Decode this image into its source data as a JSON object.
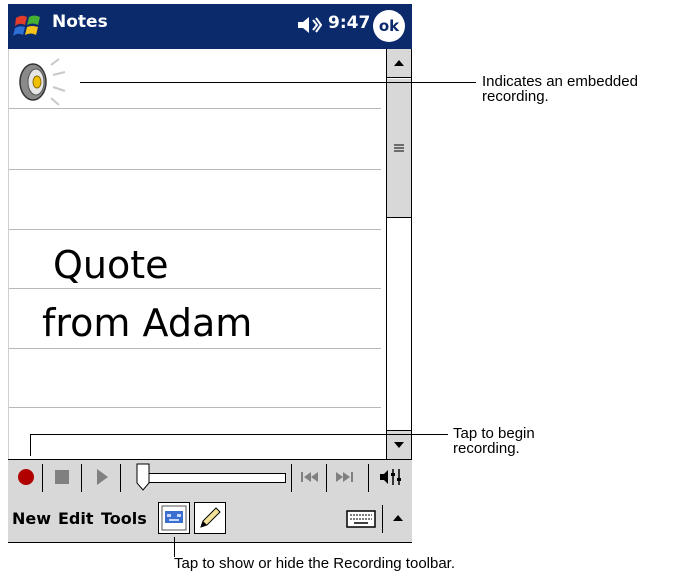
{
  "titlebar": {
    "app_title": "Notes",
    "time": "9:47",
    "ok_label": "ok"
  },
  "note": {
    "lines": [
      "Quote",
      "from Adam"
    ]
  },
  "menubar": {
    "items": [
      "New",
      "Edit",
      "Tools"
    ]
  },
  "callouts": {
    "recording_line1": "Indicates an embedded",
    "recording_line2": "recording.",
    "begin_line1": "Tap to begin",
    "begin_line2": "recording.",
    "toolbar_hint": "Tap to show or hide the Recording toolbar."
  },
  "icons": [
    "windows-start-icon",
    "speaker-icon",
    "embedded-recording-icon",
    "record-icon",
    "stop-icon",
    "play-icon",
    "skip-back-icon",
    "skip-forward-icon",
    "volume-icon",
    "recording-toolbar-icon",
    "pen-icon",
    "keyboard-icon",
    "input-menu-arrow-icon"
  ],
  "colors": {
    "titlebar": "#0a2a6c",
    "record": "#b00000",
    "chrome": "#d8d8d8"
  }
}
